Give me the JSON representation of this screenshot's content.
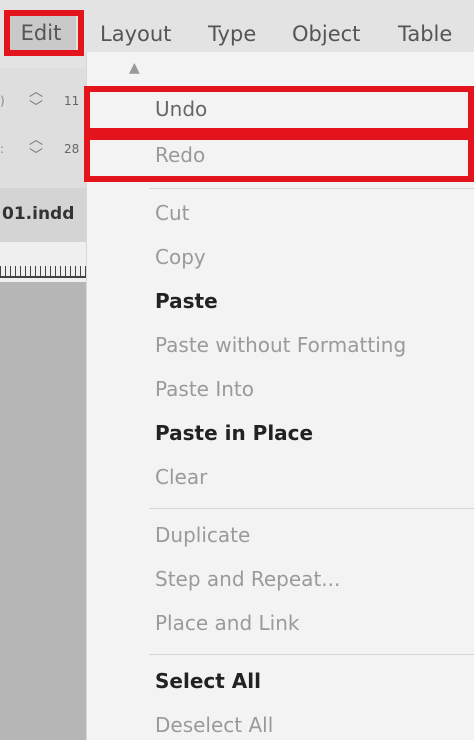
{
  "menubar": {
    "items": [
      "Edit",
      "Layout",
      "Type",
      "Object",
      "Table"
    ]
  },
  "left_panel": {
    "row1_value": "11",
    "row2_value": "28",
    "doc_tab": "01.indd"
  },
  "edit_menu": {
    "items": [
      {
        "label": "Undo",
        "state": "enabled"
      },
      {
        "label": "Redo",
        "state": "disabled"
      },
      {
        "label": "Cut",
        "state": "disabled"
      },
      {
        "label": "Copy",
        "state": "disabled"
      },
      {
        "label": "Paste",
        "state": "bold"
      },
      {
        "label": "Paste without Formatting",
        "state": "disabled"
      },
      {
        "label": "Paste Into",
        "state": "disabled"
      },
      {
        "label": "Paste in Place",
        "state": "bold"
      },
      {
        "label": "Clear",
        "state": "disabled"
      },
      {
        "label": "Duplicate",
        "state": "disabled"
      },
      {
        "label": "Step and Repeat...",
        "state": "disabled"
      },
      {
        "label": "Place and Link",
        "state": "disabled"
      },
      {
        "label": "Select All",
        "state": "bold"
      },
      {
        "label": "Deselect All",
        "state": "disabled"
      }
    ]
  },
  "colors": {
    "highlight": "#e3141c",
    "menu_bg": "#f3f3f3",
    "menubar_bg": "#e3e3e3"
  }
}
